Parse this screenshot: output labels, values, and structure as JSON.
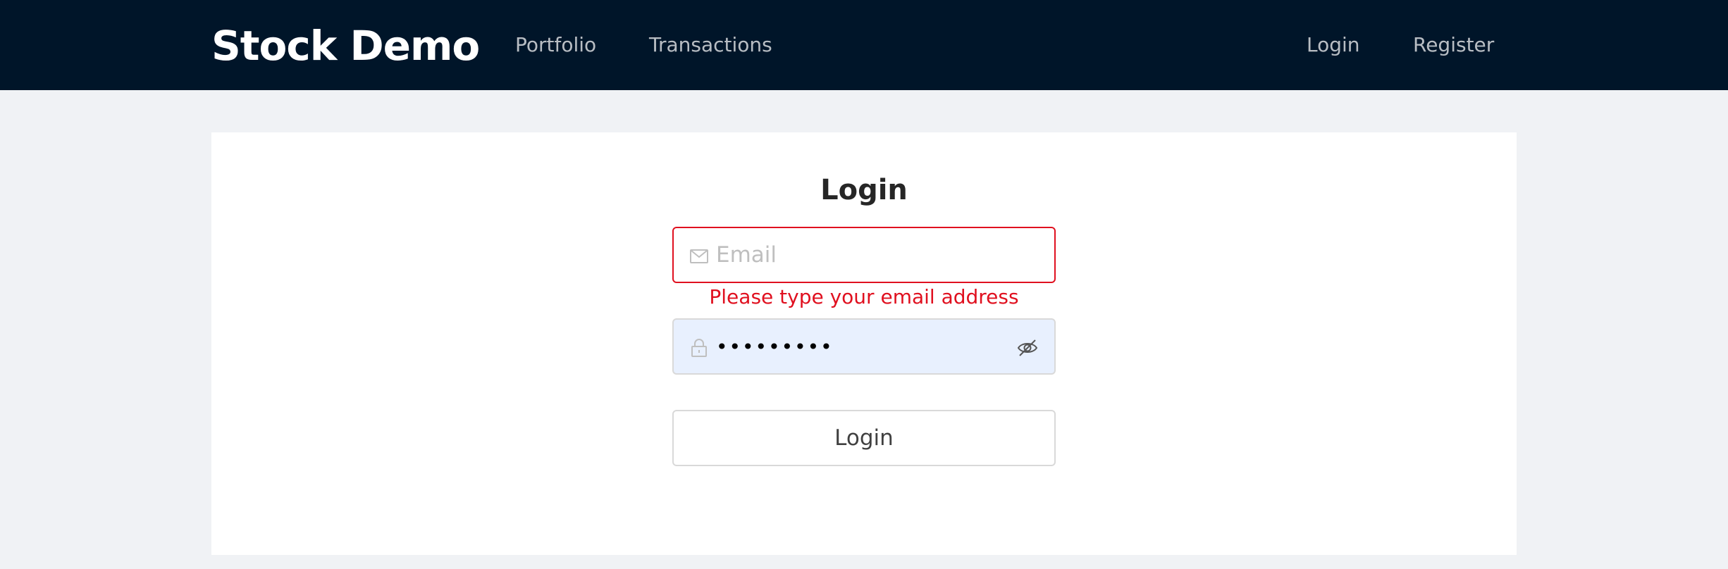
{
  "header": {
    "brand": "Stock Demo",
    "nav_left": [
      "Portfolio",
      "Transactions"
    ],
    "nav_right": [
      "Login",
      "Register"
    ]
  },
  "form": {
    "title": "Login",
    "email": {
      "placeholder": "Email",
      "value": "",
      "icon": "mail-icon"
    },
    "email_error": "Please type your email address",
    "password": {
      "value": "•••••••••",
      "icon": "lock-icon",
      "toggle_icon": "eye-invisible-icon"
    },
    "submit_label": "Login"
  },
  "colors": {
    "header_bg": "#001529",
    "page_bg": "#f0f2f5",
    "error": "#e0101f",
    "autofill_bg": "#e8f0fe"
  }
}
